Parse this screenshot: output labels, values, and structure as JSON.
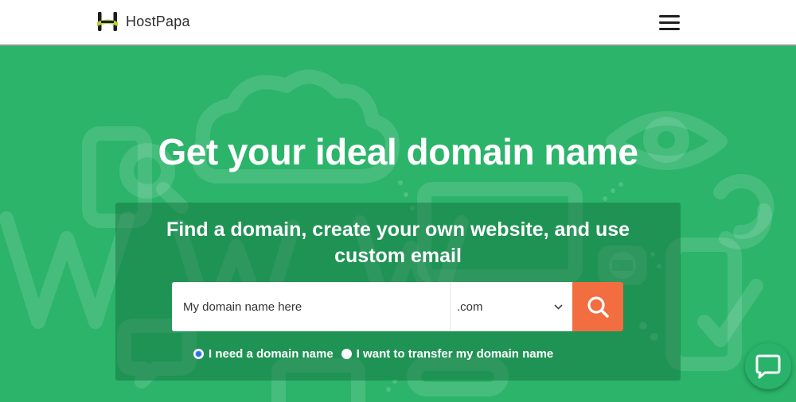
{
  "header": {
    "brand": "HostPapa",
    "logo_icon": "hostpapa-logo-icon",
    "menu_icon": "hamburger-menu-icon"
  },
  "hero": {
    "headline": "Get your ideal domain name",
    "subheadline": "Find a domain, create your own website, and use custom email",
    "background_letters": "www"
  },
  "search": {
    "placeholder": "My domain name here",
    "value": "",
    "tld_selected": ".com",
    "search_icon": "magnifier-icon"
  },
  "options": [
    {
      "label": "I need a domain name",
      "checked": true
    },
    {
      "label": "I want to transfer my domain name",
      "checked": false
    }
  ],
  "colors": {
    "hero_green": "#2bb46a",
    "panel_dark": "#1e7a46",
    "search_orange": "#f26d40",
    "radio_blue": "#2f6fe0"
  },
  "chat": {
    "icon": "chat-bubble-icon"
  }
}
